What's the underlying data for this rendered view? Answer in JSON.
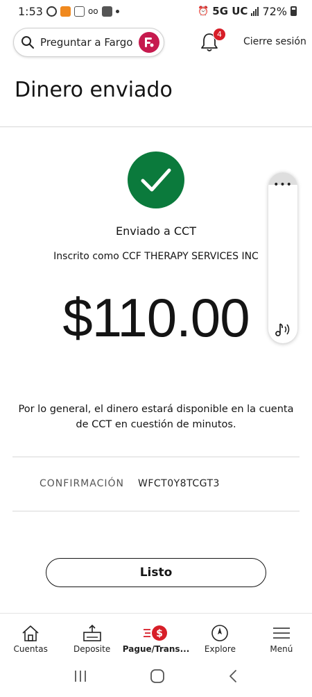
{
  "status_bar": {
    "time": "1:53",
    "network": "5G UC",
    "battery": "72%"
  },
  "header": {
    "search_placeholder": "Preguntar a Fargo",
    "notification_count": "4",
    "signout_label": "Cierre sesión"
  },
  "page": {
    "title": "Dinero enviado"
  },
  "confirmation": {
    "sent_to": "Enviado a CCT",
    "enrolled_as": "Inscrito como CCF THERAPY SERVICES INC",
    "amount": "$110.00",
    "availability_message": "Por lo general, el dinero estará disponible en la cuenta de CCT en cuestión de minutos.",
    "confirmation_label": "CONFIRMACIÓN",
    "confirmation_number": "WFCT0Y8TCGT3",
    "done_label": "Listo"
  },
  "bottom_nav": {
    "items": [
      {
        "label": "Cuentas",
        "icon": "home-icon"
      },
      {
        "label": "Deposite",
        "icon": "deposit-icon"
      },
      {
        "label": "Pague/Trans...",
        "icon": "pay-transfer-icon"
      },
      {
        "label": "Explore",
        "icon": "compass-icon"
      },
      {
        "label": "Menú",
        "icon": "menu-icon"
      }
    ]
  },
  "colors": {
    "success_green": "#0b7a3c",
    "brand_red": "#d71e28",
    "fargo_magenta": "#c61a4e"
  }
}
